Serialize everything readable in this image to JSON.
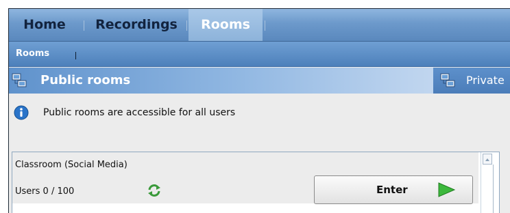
{
  "nav": {
    "tabs": [
      {
        "label": "Home"
      },
      {
        "label": "Recordings"
      },
      {
        "label": "Rooms",
        "active": true
      }
    ]
  },
  "subnav": {
    "tabs": [
      {
        "label": "Rooms",
        "active": true
      }
    ]
  },
  "section": {
    "public_title": "Public rooms",
    "private_label": "Private"
  },
  "info": {
    "icon": "info-icon",
    "text": "Public rooms are accessible for all users"
  },
  "rooms": [
    {
      "name": "Classroom (Social Media)",
      "users": "Users 0 / 100",
      "enter_label": "Enter"
    }
  ],
  "colors": {
    "nav_blue": "#6c99cb",
    "active_tab": "#a9c8e8",
    "play_green": "#3cb83c"
  }
}
